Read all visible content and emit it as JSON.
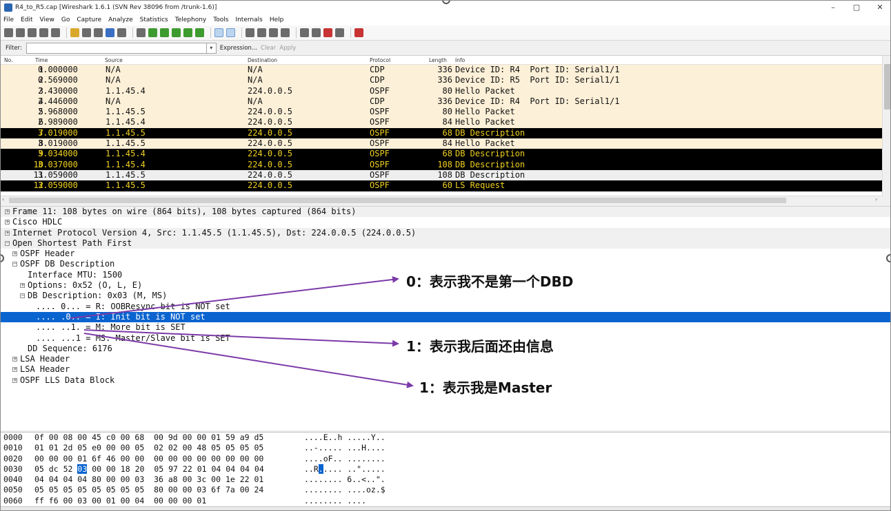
{
  "window": {
    "title": "R4_to_R5.cap  [Wireshark 1.6.1  (SVN Rev 38096 from /trunk-1.6)]",
    "controls": [
      "–",
      "▢",
      "✕"
    ]
  },
  "menu": [
    "File",
    "Edit",
    "View",
    "Go",
    "Capture",
    "Analyze",
    "Statistics",
    "Telephony",
    "Tools",
    "Internals",
    "Help"
  ],
  "filter": {
    "label": "Filter:",
    "value": "",
    "buttons": [
      "Expression...",
      "Clear",
      "Apply"
    ]
  },
  "packet_list": {
    "columns": [
      "No.",
      "Time",
      "Source",
      "Destination",
      "Protocol",
      "Length",
      "Info"
    ],
    "rows": [
      {
        "no": "1",
        "time": "0.000000",
        "src": "N/A",
        "dst": "N/A",
        "proto": "CDP",
        "len": "336",
        "info": "Device ID: R4  Port ID: Serial1/1",
        "style": "light"
      },
      {
        "no": "2",
        "time": "0.569000",
        "src": "N/A",
        "dst": "N/A",
        "proto": "CDP",
        "len": "336",
        "info": "Device ID: R5  Port ID: Serial1/1",
        "style": "light"
      },
      {
        "no": "3",
        "time": "2.430000",
        "src": "1.1.45.4",
        "dst": "224.0.0.5",
        "proto": "OSPF",
        "len": "80",
        "info": "Hello Packet",
        "style": "light"
      },
      {
        "no": "4",
        "time": "2.446000",
        "src": "N/A",
        "dst": "N/A",
        "proto": "CDP",
        "len": "336",
        "info": "Device ID: R4  Port ID: Serial1/1",
        "style": "light"
      },
      {
        "no": "5",
        "time": "2.968000",
        "src": "1.1.45.5",
        "dst": "224.0.0.5",
        "proto": "OSPF",
        "len": "80",
        "info": "Hello Packet",
        "style": "light"
      },
      {
        "no": "6",
        "time": "2.989000",
        "src": "1.1.45.4",
        "dst": "224.0.0.5",
        "proto": "OSPF",
        "len": "84",
        "info": "Hello Packet",
        "style": "light"
      },
      {
        "no": "7",
        "time": "3.019000",
        "src": "1.1.45.5",
        "dst": "224.0.0.5",
        "proto": "OSPF",
        "len": "68",
        "info": "DB Description",
        "style": "dark"
      },
      {
        "no": "8",
        "time": "3.019000",
        "src": "1.1.45.5",
        "dst": "224.0.0.5",
        "proto": "OSPF",
        "len": "84",
        "info": "Hello Packet",
        "style": "light"
      },
      {
        "no": "9",
        "time": "3.034000",
        "src": "1.1.45.4",
        "dst": "224.0.0.5",
        "proto": "OSPF",
        "len": "68",
        "info": "DB Description",
        "style": "dark"
      },
      {
        "no": "10",
        "time": "3.037000",
        "src": "1.1.45.4",
        "dst": "224.0.0.5",
        "proto": "OSPF",
        "len": "108",
        "info": "DB Description",
        "style": "dark"
      },
      {
        "no": "11",
        "time": "3.059000",
        "src": "1.1.45.5",
        "dst": "224.0.0.5",
        "proto": "OSPF",
        "len": "108",
        "info": "DB Description",
        "style": "gray"
      },
      {
        "no": "12",
        "time": "3.059000",
        "src": "1.1.45.5",
        "dst": "224.0.0.5",
        "proto": "OSPF",
        "len": "60",
        "info": "LS Request",
        "style": "dark"
      }
    ]
  },
  "detail_tree": [
    {
      "indent": 0,
      "exp": "+",
      "text": "Frame 11: 108 bytes on wire (864 bits), 108 bytes captured (864 bits)",
      "style": "shade"
    },
    {
      "indent": 0,
      "exp": "+",
      "text": "Cisco HDLC",
      "style": "plain"
    },
    {
      "indent": 0,
      "exp": "+",
      "text": "Internet Protocol Version 4, Src: 1.1.45.5 (1.1.45.5), Dst: 224.0.0.5 (224.0.0.5)",
      "style": "shade"
    },
    {
      "indent": 0,
      "exp": "-",
      "text": "Open Shortest Path First",
      "style": "shade"
    },
    {
      "indent": 1,
      "exp": "+",
      "text": "OSPF Header",
      "style": "plain"
    },
    {
      "indent": 1,
      "exp": "-",
      "text": "OSPF DB Description",
      "style": "plain"
    },
    {
      "indent": 2,
      "exp": "",
      "text": "Interface MTU: 1500",
      "style": "plain"
    },
    {
      "indent": 2,
      "exp": "+",
      "text": "Options: 0x52 (O, L, E)",
      "style": "plain"
    },
    {
      "indent": 2,
      "exp": "-",
      "text": "DB Description: 0x03 (M, MS)",
      "style": "plain"
    },
    {
      "indent": 3,
      "exp": "",
      "text": ".... 0... = R: OOBResync bit is NOT set",
      "style": "plain"
    },
    {
      "indent": 3,
      "exp": "",
      "text": ".... .0.. = I: Init bit is NOT set",
      "style": "selected"
    },
    {
      "indent": 3,
      "exp": "",
      "text": ".... ..1. = M: More bit is SET",
      "style": "plain"
    },
    {
      "indent": 3,
      "exp": "",
      "text": ".... ...1 = MS: Master/Slave bit is SET",
      "style": "plain"
    },
    {
      "indent": 2,
      "exp": "",
      "text": "DD Sequence: 6176",
      "style": "plain"
    },
    {
      "indent": 1,
      "exp": "+",
      "text": "LSA Header",
      "style": "plain"
    },
    {
      "indent": 1,
      "exp": "+",
      "text": "LSA Header",
      "style": "plain"
    },
    {
      "indent": 1,
      "exp": "+",
      "text": "OSPF LLS Data Block",
      "style": "plain"
    }
  ],
  "hex_dump": [
    {
      "offset": "0000",
      "bytes": "0f 00 08 00 45 c0 00 68  00 9d 00 00 01 59 a9 d5",
      "ascii": "....E..h .....Y.."
    },
    {
      "offset": "0010",
      "bytes": "01 01 2d 05 e0 00 00 05  02 02 00 48 05 05 05 05",
      "ascii": "..-..... ...H...."
    },
    {
      "offset": "0020",
      "bytes": "00 00 00 01 6f 46 00 00  00 00 00 00 00 00 00 00",
      "ascii": "....oF.. ........"
    },
    {
      "offset": "0030",
      "bytes": "05 dc 52 03 00 00 18 20  05 97 22 01 04 04 04 04",
      "ascii": "..R..... ..\"....."
    },
    {
      "offset": "0040",
      "bytes": "04 04 04 04 80 00 00 03  36 a8 00 3c 00 1e 22 01",
      "ascii": "........ 6..<..\"."
    },
    {
      "offset": "0050",
      "bytes": "05 05 05 05 05 05 05 05  80 00 00 03 6f 7a 00 24",
      "ascii": "........ ....oz.$"
    },
    {
      "offset": "0060",
      "bytes": "ff f6 00 03 00 01 00 04  00 00 00 01",
      "ascii": "........ ...."
    }
  ],
  "hex_highlight": {
    "row": 3,
    "byte_index": 3,
    "ascii_index": 3
  },
  "annotations": [
    {
      "text": "0：表示我不是第一个DBD"
    },
    {
      "text": "1：表示我后面还由信息"
    },
    {
      "text": "1：表示我是Master"
    }
  ],
  "colors": {
    "light_row": "#fdf0d8",
    "dark_row": "#000000",
    "dark_row_text": "#f0d020",
    "selected": "#0a64d0",
    "arrow": "#7b3aa8"
  }
}
